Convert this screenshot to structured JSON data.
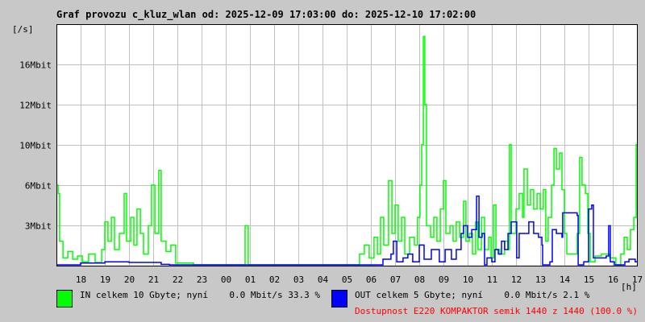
{
  "chart_data": {
    "type": "line",
    "title": "Graf provozu c_kluz_wlan od: 2025-12-09 17:03:00 do: 2025-12-10 17:02:00",
    "ylabel": "[/s]",
    "xlabel": "[h]",
    "xlim": [
      0,
      24
    ],
    "ylim": [
      0,
      18.75
    ],
    "grid": true,
    "x_unit": "hours since 2025-12-09 17:03",
    "y_unit": "Mbit/s",
    "yticks": [
      {
        "value": 3.125,
        "label": "3Mbit"
      },
      {
        "value": 6.25,
        "label": "6Mbit"
      },
      {
        "value": 9.375,
        "label": "10Mbit"
      },
      {
        "value": 12.5,
        "label": "12Mbit"
      },
      {
        "value": 15.625,
        "label": "16Mbit"
      }
    ],
    "xticks": [
      {
        "value": 1,
        "label": "18"
      },
      {
        "value": 2,
        "label": "19"
      },
      {
        "value": 3,
        "label": "20"
      },
      {
        "value": 4,
        "label": "21"
      },
      {
        "value": 5,
        "label": "22"
      },
      {
        "value": 6,
        "label": "23"
      },
      {
        "value": 7,
        "label": "00"
      },
      {
        "value": 8,
        "label": "01"
      },
      {
        "value": 9,
        "label": "02"
      },
      {
        "value": 10,
        "label": "03"
      },
      {
        "value": 11,
        "label": "04"
      },
      {
        "value": 12,
        "label": "05"
      },
      {
        "value": 13,
        "label": "06"
      },
      {
        "value": 14,
        "label": "07"
      },
      {
        "value": 15,
        "label": "08"
      },
      {
        "value": 16,
        "label": "09"
      },
      {
        "value": 17,
        "label": "10"
      },
      {
        "value": 18,
        "label": "11"
      },
      {
        "value": 19,
        "label": "12"
      },
      {
        "value": 20,
        "label": "13"
      },
      {
        "value": 21,
        "label": "14"
      },
      {
        "value": 22,
        "label": "15"
      },
      {
        "value": 23,
        "label": "16"
      },
      {
        "value": 24,
        "label": "17"
      }
    ],
    "series": [
      {
        "name": "IN",
        "color": "#00ff00",
        "points": [
          [
            0,
            6.25
          ],
          [
            0.07,
            5.6
          ],
          [
            0.13,
            1.9
          ],
          [
            0.27,
            0.6
          ],
          [
            0.47,
            1.1
          ],
          [
            0.67,
            0.5
          ],
          [
            0.87,
            0.75
          ],
          [
            1.07,
            0.3
          ],
          [
            1.33,
            0.9
          ],
          [
            1.6,
            0.25
          ],
          [
            1.87,
            1.25
          ],
          [
            2.0,
            3.4
          ],
          [
            2.13,
            1.9
          ],
          [
            2.27,
            3.75
          ],
          [
            2.4,
            1.25
          ],
          [
            2.6,
            2.5
          ],
          [
            2.8,
            5.6
          ],
          [
            2.9,
            1.9
          ],
          [
            3.07,
            3.75
          ],
          [
            3.2,
            1.6
          ],
          [
            3.33,
            4.4
          ],
          [
            3.47,
            2.5
          ],
          [
            3.6,
            0.9
          ],
          [
            3.8,
            3.1
          ],
          [
            3.93,
            6.25
          ],
          [
            4.07,
            2.5
          ],
          [
            4.23,
            7.4
          ],
          [
            4.33,
            1.9
          ],
          [
            4.53,
            1.1
          ],
          [
            4.73,
            1.6
          ],
          [
            4.93,
            0.2
          ],
          [
            5.67,
            0
          ],
          [
            7.67,
            0
          ],
          [
            7.8,
            3.1
          ],
          [
            7.87,
            3.1
          ],
          [
            7.93,
            0
          ],
          [
            12.33,
            0
          ],
          [
            12.53,
            0.9
          ],
          [
            12.73,
            1.6
          ],
          [
            12.93,
            0.6
          ],
          [
            13.13,
            2.2
          ],
          [
            13.27,
            0.9
          ],
          [
            13.4,
            3.75
          ],
          [
            13.53,
            1.6
          ],
          [
            13.73,
            6.6
          ],
          [
            13.87,
            2.5
          ],
          [
            14.0,
            4.7
          ],
          [
            14.13,
            1.9
          ],
          [
            14.27,
            3.75
          ],
          [
            14.4,
            0.9
          ],
          [
            14.6,
            2.2
          ],
          [
            14.8,
            1.6
          ],
          [
            14.93,
            3.75
          ],
          [
            15.03,
            6.25
          ],
          [
            15.1,
            9.4
          ],
          [
            15.17,
            17.8
          ],
          [
            15.23,
            12.5
          ],
          [
            15.3,
            3.1
          ],
          [
            15.47,
            2.2
          ],
          [
            15.6,
            3.75
          ],
          [
            15.73,
            1.9
          ],
          [
            15.87,
            4.4
          ],
          [
            16.0,
            6.6
          ],
          [
            16.1,
            2.5
          ],
          [
            16.27,
            3.1
          ],
          [
            16.4,
            1.9
          ],
          [
            16.53,
            3.4
          ],
          [
            16.67,
            2.2
          ],
          [
            16.83,
            5.0
          ],
          [
            16.93,
            1.9
          ],
          [
            17.07,
            2.5
          ],
          [
            17.2,
            0.9
          ],
          [
            17.33,
            3.4
          ],
          [
            17.43,
            1.25
          ],
          [
            17.57,
            3.75
          ],
          [
            17.7,
            1.25
          ],
          [
            17.87,
            2.2
          ],
          [
            17.97,
            0.6
          ],
          [
            18.07,
            4.7
          ],
          [
            18.17,
            1.25
          ],
          [
            18.33,
            0.9
          ],
          [
            18.53,
            1.9
          ],
          [
            18.67,
            1.25
          ],
          [
            18.73,
            9.4
          ],
          [
            18.8,
            2.5
          ],
          [
            19.0,
            4.4
          ],
          [
            19.13,
            5.6
          ],
          [
            19.27,
            3.75
          ],
          [
            19.33,
            7.5
          ],
          [
            19.47,
            4.7
          ],
          [
            19.6,
            5.9
          ],
          [
            19.73,
            4.4
          ],
          [
            19.87,
            5.6
          ],
          [
            20.0,
            4.4
          ],
          [
            20.13,
            5.9
          ],
          [
            20.23,
            1.9
          ],
          [
            20.33,
            3.75
          ],
          [
            20.47,
            6.25
          ],
          [
            20.57,
            9.1
          ],
          [
            20.67,
            7.5
          ],
          [
            20.8,
            8.75
          ],
          [
            20.9,
            5.9
          ],
          [
            21.0,
            2.5
          ],
          [
            21.1,
            0.9
          ],
          [
            21.4,
            0.9
          ],
          [
            21.53,
            2.5
          ],
          [
            21.63,
            8.4
          ],
          [
            21.73,
            6.25
          ],
          [
            21.87,
            5.6
          ],
          [
            21.97,
            2.5
          ],
          [
            22.07,
            0.3
          ],
          [
            22.27,
            0.75
          ],
          [
            22.53,
            0.9
          ],
          [
            22.87,
            0.6
          ],
          [
            23.13,
            0
          ],
          [
            23.33,
            0.9
          ],
          [
            23.47,
            2.2
          ],
          [
            23.6,
            1.25
          ],
          [
            23.73,
            2.8
          ],
          [
            23.87,
            3.75
          ],
          [
            23.97,
            9.4
          ]
        ]
      },
      {
        "name": "OUT",
        "color": "#0000ff",
        "points": [
          [
            0,
            0
          ],
          [
            1,
            0.2
          ],
          [
            2,
            0.3
          ],
          [
            3,
            0.25
          ],
          [
            4.33,
            0.1
          ],
          [
            4.67,
            0
          ],
          [
            13.33,
            0
          ],
          [
            13.5,
            0.5
          ],
          [
            13.83,
            0.9
          ],
          [
            13.93,
            1.9
          ],
          [
            14.07,
            0.3
          ],
          [
            14.33,
            0.6
          ],
          [
            14.53,
            0.9
          ],
          [
            14.73,
            0.3
          ],
          [
            15,
            1.6
          ],
          [
            15.2,
            0.5
          ],
          [
            15.5,
            1.25
          ],
          [
            15.83,
            0.3
          ],
          [
            16.07,
            1.25
          ],
          [
            16.33,
            0.5
          ],
          [
            16.53,
            1.25
          ],
          [
            16.73,
            2.5
          ],
          [
            16.83,
            3.1
          ],
          [
            17,
            2.2
          ],
          [
            17.17,
            2.8
          ],
          [
            17.37,
            5.4
          ],
          [
            17.47,
            2.2
          ],
          [
            17.6,
            2.5
          ],
          [
            17.7,
            0
          ],
          [
            17.8,
            0.6
          ],
          [
            18,
            0.3
          ],
          [
            18.13,
            1.25
          ],
          [
            18.27,
            0.9
          ],
          [
            18.4,
            1.9
          ],
          [
            18.53,
            1.25
          ],
          [
            18.67,
            2.5
          ],
          [
            18.8,
            3.4
          ],
          [
            18.93,
            3.4
          ],
          [
            19.03,
            0.6
          ],
          [
            19.13,
            2.5
          ],
          [
            19.4,
            2.5
          ],
          [
            19.53,
            3.4
          ],
          [
            19.73,
            2.5
          ],
          [
            19.93,
            2.2
          ],
          [
            20.07,
            1.6
          ],
          [
            20.1,
            0
          ],
          [
            20.4,
            0.3
          ],
          [
            20.5,
            2.8
          ],
          [
            20.67,
            2.5
          ],
          [
            20.9,
            2.2
          ],
          [
            20.93,
            4.1
          ],
          [
            21.53,
            3.9
          ],
          [
            21.57,
            0
          ],
          [
            21.8,
            0.3
          ],
          [
            22,
            4.4
          ],
          [
            22.13,
            4.7
          ],
          [
            22.2,
            0.6
          ],
          [
            22.73,
            0.75
          ],
          [
            22.83,
            3.1
          ],
          [
            22.9,
            0.3
          ],
          [
            23.07,
            0
          ],
          [
            23.5,
            0.3
          ],
          [
            23.67,
            0.5
          ],
          [
            23.93,
            0.3
          ]
        ]
      }
    ]
  },
  "legend": {
    "in_text": "IN celkem 10 Gbyte; nyní    0.0 Mbit/s 33.3 %",
    "out_text": "OUT celkem 5 Gbyte; nyní    0.0 Mbit/s 2.1 %",
    "availability_text": "Dostupnost E220 KOMPAKTOR semik 1440 z 1440 (100.0 %)",
    "availability_color": "#ff0000"
  }
}
